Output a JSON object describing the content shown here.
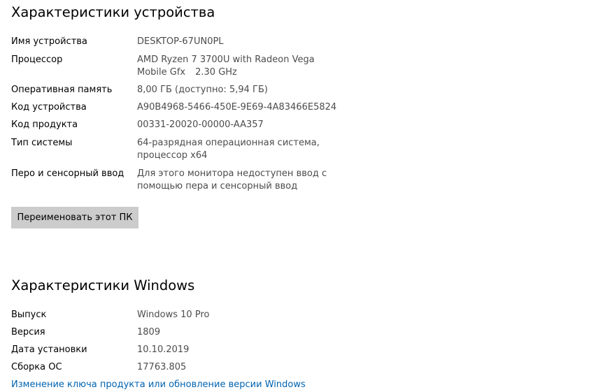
{
  "device_specs": {
    "title": "Характеристики устройства",
    "rows": [
      {
        "label": "Имя устройства",
        "value": "DESKTOP-67UN0PL"
      },
      {
        "label": "Процессор",
        "value_line1": "AMD Ryzen 7 3700U with Radeon Vega",
        "value_line2a": "Mobile Gfx",
        "value_line2b": "2.30 GHz"
      },
      {
        "label": "Оперативная память",
        "value": "8,00 ГБ (доступно: 5,94 ГБ)"
      },
      {
        "label": "Код устройства",
        "value": "A90B4968-5466-450E-9E69-4A83466E5824"
      },
      {
        "label": "Код продукта",
        "value": "00331-20020-00000-AA357"
      },
      {
        "label": "Тип системы",
        "value_line1": "64-разрядная операционная система,",
        "value_line2": "процессор x64"
      },
      {
        "label": "Перо и сенсорный ввод",
        "value_line1": "Для этого монитора недоступен ввод с",
        "value_line2": "помощью пера и сенсорный ввод"
      }
    ],
    "rename_button": "Переименовать этот ПК"
  },
  "windows_specs": {
    "title": "Характеристики Windows",
    "rows": [
      {
        "label": "Выпуск",
        "value": "Windows 10 Pro"
      },
      {
        "label": "Версия",
        "value": "1809"
      },
      {
        "label": "Дата установки",
        "value": "10.10.2019"
      },
      {
        "label": "Сборка ОС",
        "value": "17763.805"
      }
    ],
    "change_key_link": "Изменение ключа продукта или обновление версии Windows"
  },
  "colors": {
    "accent_link": "#0063b1",
    "button_bg": "#cccccc",
    "value_text": "#4c4c4c"
  }
}
